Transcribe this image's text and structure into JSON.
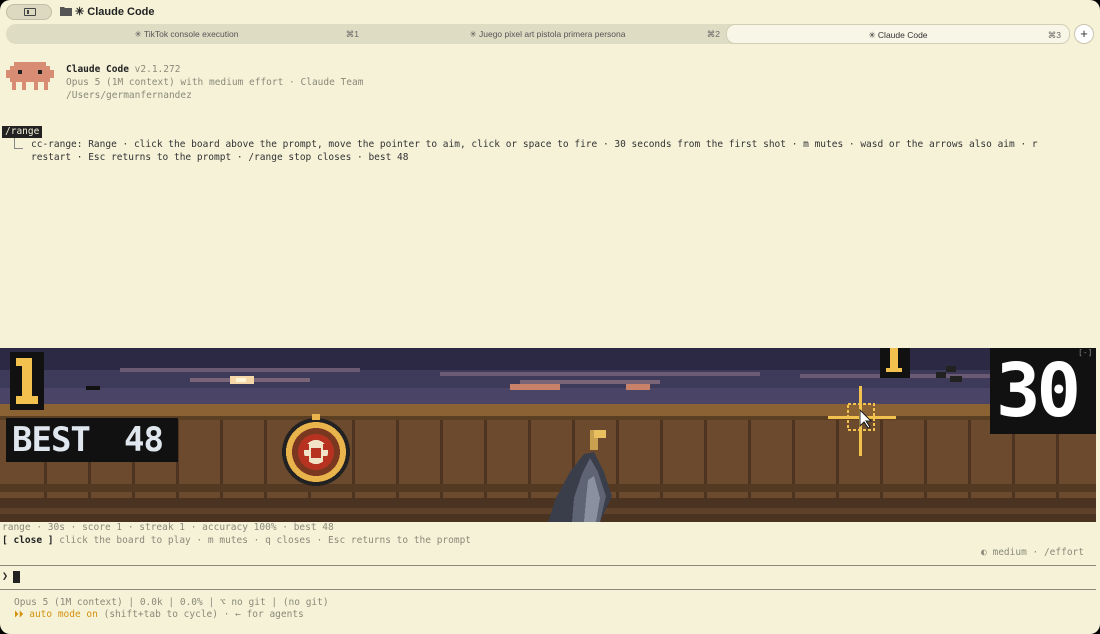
{
  "window": {
    "title": "✳ Claude Code"
  },
  "tabs": [
    {
      "label": "✳ TikTok console execution",
      "shortcut": "⌘1",
      "active": false
    },
    {
      "label": "✳ Juego pixel art pistola primera persona",
      "shortcut": "⌘2",
      "active": false
    },
    {
      "label": "✳ Claude Code",
      "shortcut": "⌘3",
      "active": true
    }
  ],
  "new_tab_label": "+",
  "header": {
    "app_name": "Claude Code",
    "version": "v2.1.272",
    "model_line": "Opus 5 (1M context) with medium effort · Claude Team",
    "cwd": "/Users/germanfernandez"
  },
  "command": "/range",
  "command_output": "cc-range: Range · click the board above the prompt, move the pointer to aim, click or space to fire · 30 seconds from the first shot · m mutes · wasd or the arrows also aim · r\nrestart · Esc returns to the prompt · /range stop closes · best 48",
  "game": {
    "collapse_label": "[-]",
    "score_display": "1",
    "best_label": "BEST",
    "best_value": "48",
    "timer": "30",
    "hit_popup": "1",
    "crosshair_color": "#f2c14e",
    "wood_color": "#6b4a2e",
    "sky_color": "#3a3550"
  },
  "status_line": "range · 30s · score 1 · streak 1 · accuracy 100% · best 48",
  "help": {
    "close_button": "[ close ]",
    "hint": "click the board to play · m mutes · q closes · Esc returns to the prompt"
  },
  "effort_indicator": "◐ medium · /effort",
  "prompt_symbol": "❯",
  "footer": {
    "info": "Opus 5 (1M context) | 0.0k | 0.0% | ⌥ no git | (no git)",
    "auto_mode": "⏵⏵ auto mode on",
    "auto_hint": "(shift+tab to cycle) · ← for agents"
  }
}
